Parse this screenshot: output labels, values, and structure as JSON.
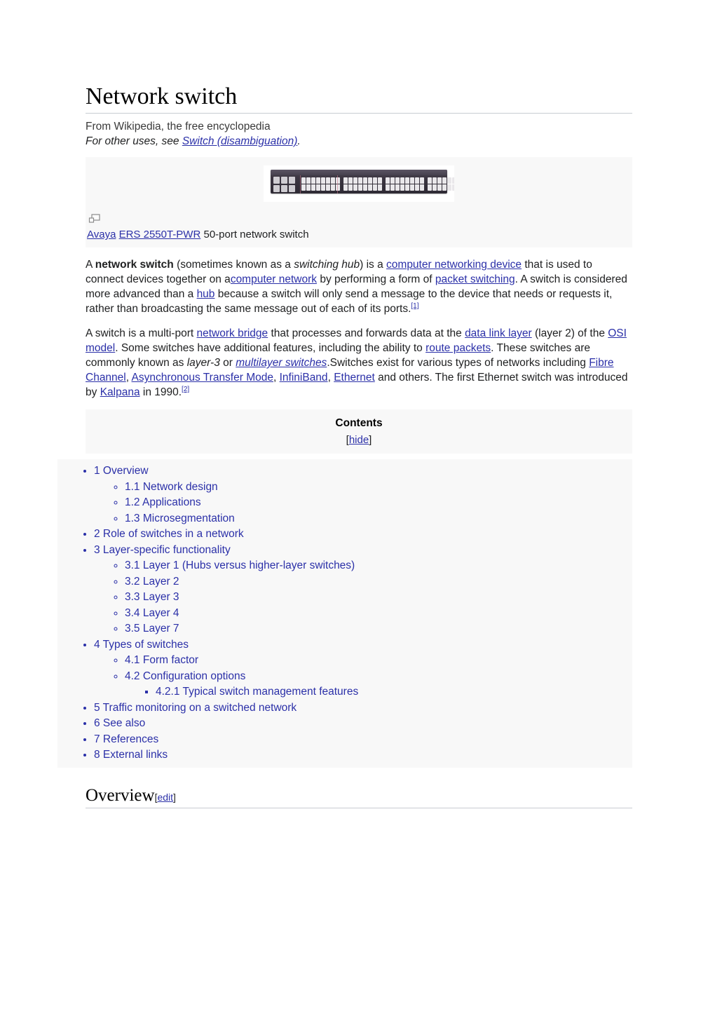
{
  "article": {
    "title": "Network switch",
    "tagline": "From Wikipedia, the free encyclopedia",
    "hatnote_prefix": "For other uses, see ",
    "hatnote_link": "Switch (disambiguation)",
    "hatnote_suffix": "."
  },
  "thumbnail": {
    "magnify_icon": "enlarge-icon",
    "caption_link_1": "Avaya",
    "caption_link_2": "ERS 2550T-PWR",
    "caption_rest": " 50-port network switch",
    "image_alt": "Avaya ERS 2550T-PWR 50-port network switch"
  },
  "lead": {
    "p1": {
      "s1": "A ",
      "term": "network switch",
      "s2": " (sometimes known as a ",
      "em1": "switching hub",
      "s3": ") is a ",
      "link1": "computer networking device",
      "s4": " that is used to connect devices together on a",
      "link2": "computer network",
      "s5": " by performing a form of ",
      "link3": "packet switching",
      "s6": ". A switch is considered more advanced than a ",
      "link4": "hub",
      "s7": " because a switch will only send a message to the device that needs or requests it, rather than broadcasting the same message out of each of its ports.",
      "ref": "[1]"
    },
    "p2": {
      "s1": "A switch is a multi-port ",
      "link1": "network bridge",
      "s2": " that processes and forwards data at the ",
      "link2": "data link layer",
      "s3": " (layer 2) of the ",
      "link3": "OSI model",
      "s4": ". Some switches have additional features, including the ability to ",
      "link4": "route packets",
      "s5": ". These switches are commonly known as ",
      "em1": "layer-3",
      "s6": " or ",
      "em2": "multilayer switches",
      "s7": ".Switches exist for various types of networks including ",
      "link5": "Fibre Channel",
      "s8": ", ",
      "link6": "Asynchronous Transfer Mode",
      "s9": ", ",
      "link7": "InfiniBand",
      "s10": ", ",
      "link8": "Ethernet",
      "s11": " and others. The first Ethernet switch was introduced by ",
      "link9": "Kalpana",
      "s12": " in 1990.",
      "ref": "[2]"
    }
  },
  "toc": {
    "title": "Contents",
    "toggle_open": "[",
    "toggle_label": "hide",
    "toggle_close": "]",
    "items": [
      {
        "num": "1",
        "label": "1 Overview",
        "children": [
          {
            "label": "1.1 Network design"
          },
          {
            "label": "1.2 Applications"
          },
          {
            "label": "1.3 Microsegmentation"
          }
        ]
      },
      {
        "num": "2",
        "label": "2 Role of switches in a network",
        "children": []
      },
      {
        "num": "3",
        "label": "3 Layer-specific functionality",
        "children": [
          {
            "label": "3.1 Layer 1 (Hubs versus higher-layer switches)"
          },
          {
            "label": "3.2 Layer 2"
          },
          {
            "label": "3.3 Layer 3"
          },
          {
            "label": "3.4 Layer 4"
          },
          {
            "label": "3.5 Layer 7"
          }
        ]
      },
      {
        "num": "4",
        "label": "4 Types of switches",
        "children": [
          {
            "label": "4.1 Form factor"
          },
          {
            "label": "4.2 Configuration options",
            "children": [
              {
                "label": "4.2.1 Typical switch management features"
              }
            ]
          }
        ]
      },
      {
        "num": "5",
        "label": "5 Traffic monitoring on a switched network",
        "children": []
      },
      {
        "num": "6",
        "label": "6 See also",
        "children": []
      },
      {
        "num": "7",
        "label": "7 References",
        "children": []
      },
      {
        "num": "8",
        "label": "8 External links",
        "children": []
      }
    ]
  },
  "section": {
    "heading": "Overview",
    "edit_open": "[",
    "edit_label": "edit",
    "edit_close": "]"
  },
  "colors": {
    "link": "#2b30a8",
    "box_bg": "#f8f8f8",
    "rule": "#c8ccd1",
    "text": "#202122"
  }
}
